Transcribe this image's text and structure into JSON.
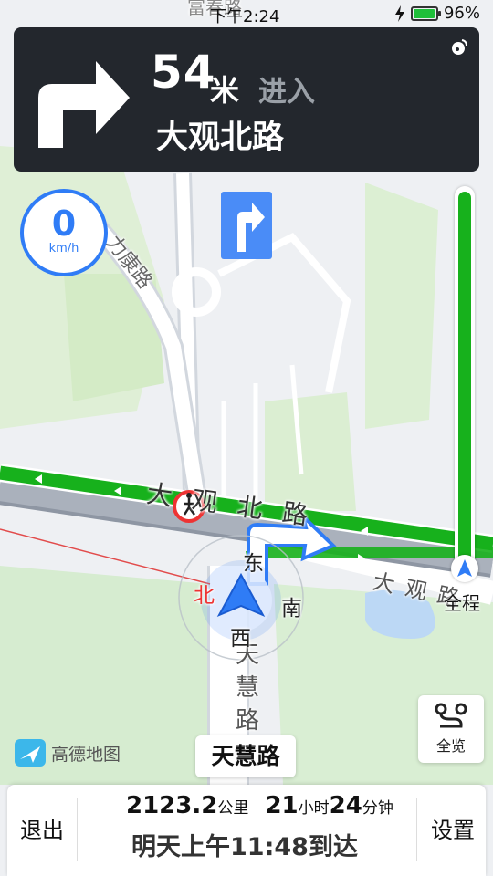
{
  "status_bar": {
    "time": "下午2:24",
    "battery": "96%"
  },
  "nav_card": {
    "distance": "54",
    "unit": "米",
    "action": "进入",
    "road": "大观北路"
  },
  "speed": {
    "value": "0",
    "unit": "km/h"
  },
  "map": {
    "labels": {
      "top_road": "富春路",
      "left_road": "力康路",
      "main_road": "大观北路",
      "right_road": "大观路",
      "vertical_road": "天慧路"
    },
    "compass": {
      "north": "北",
      "east": "东",
      "south": "南",
      "west": "西"
    }
  },
  "progress": {
    "label": "全程",
    "fraction": 1.0
  },
  "overview": {
    "label": "全览",
    "icon": "route-overview-icon"
  },
  "logo": {
    "text": "高德地图"
  },
  "current_street": "天慧路",
  "bottom_bar": {
    "exit": "退出",
    "distance": "2123.2",
    "distance_unit": "公里",
    "hours": "21",
    "hours_unit": "小时",
    "minutes": "24",
    "minutes_unit": "分钟",
    "eta": "明天上午11:48到达",
    "settings": "设置"
  },
  "colors": {
    "route": "#17b11c",
    "accent": "#2f7cf6",
    "card": "#23272d"
  }
}
